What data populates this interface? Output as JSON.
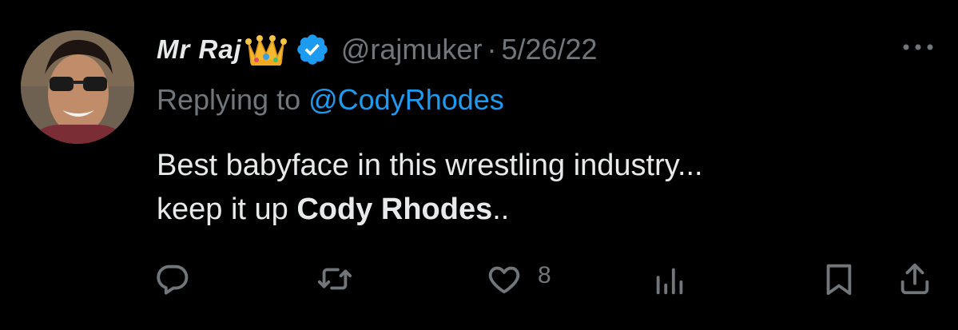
{
  "tweet": {
    "author": {
      "display_name": "Mr Raj",
      "emoji": "crown",
      "verified_badge": "verified-badge-icon",
      "handle": "@rajmuker"
    },
    "separator": "·",
    "date": "5/26/22",
    "reply": {
      "prefix": "Replying to ",
      "mention": "@CodyRhodes"
    },
    "text": {
      "line1": "Best babyface in this wrestling industry...",
      "line2_prefix": "keep it up ",
      "line2_bold": "Cody Rhodes",
      "line2_suffix": ".."
    },
    "actions": {
      "reply_icon": "reply-icon",
      "retweet_icon": "retweet-icon",
      "like_icon": "heart-icon",
      "like_count": "8",
      "views_icon": "analytics-icon",
      "bookmark_icon": "bookmark-icon",
      "share_icon": "share-icon"
    }
  },
  "colors": {
    "background": "#000000",
    "text": "#e7e9ea",
    "secondary": "#71767b",
    "accent": "#1d9bf0"
  }
}
